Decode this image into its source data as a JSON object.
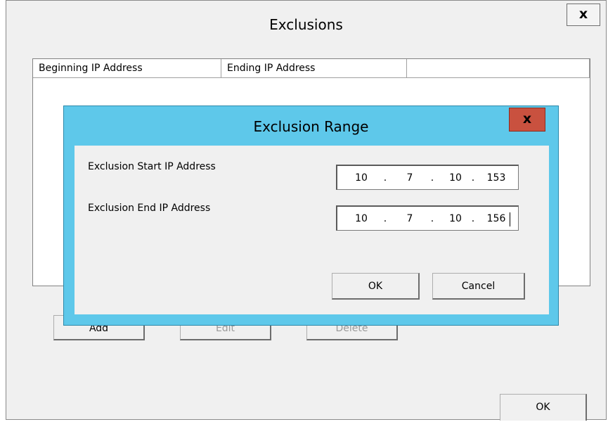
{
  "outer_window": {
    "title": "Exclusions",
    "close_glyph": "x",
    "columns": [
      "Beginning IP Address",
      "Ending IP Address",
      ""
    ],
    "buttons": {
      "add": "Add",
      "edit": "Edit",
      "delete": "Delete",
      "ok": "OK"
    }
  },
  "dialog": {
    "title": "Exclusion Range",
    "close_glyph": "x",
    "start_label": "Exclusion Start IP Address",
    "end_label": "Exclusion End IP Address",
    "start_ip": [
      "10",
      "7",
      "10",
      "153"
    ],
    "end_ip": [
      "10",
      "7",
      "10",
      "156"
    ],
    "ip_separator": ".",
    "ok_label": "OK",
    "cancel_label": "Cancel"
  },
  "colors": {
    "dialog_frame": "#5ec8ea",
    "dialog_close_bg": "#c9513f",
    "window_bg": "#f0f0f0"
  }
}
